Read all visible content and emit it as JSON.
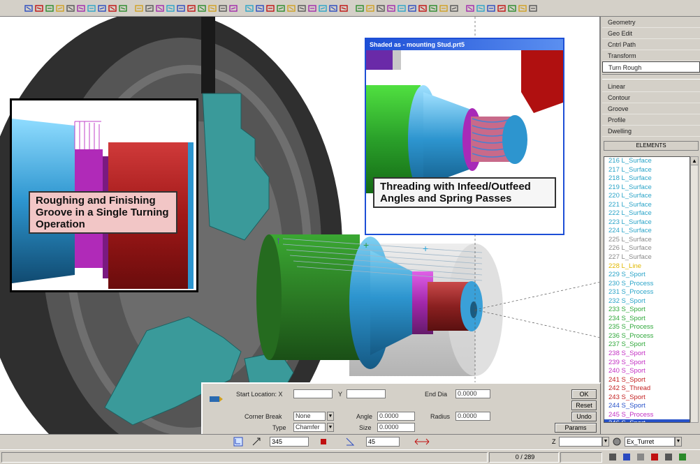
{
  "toolbar": {
    "icons": [
      "new-file-icon",
      "open-icon",
      "save-icon",
      "print-icon",
      "undo-icon",
      "redo-icon",
      "cut-icon",
      "copy-icon",
      "paste-icon",
      "select-icon",
      "mirror-icon",
      "wireframe-icon",
      "chart-icon",
      "tool-icon",
      "pen-icon",
      "curve-icon",
      "zoom-icon",
      "transform-icon",
      "dimension-icon",
      "grid-icon",
      "layer-icon",
      "view-icon",
      "rotate-icon",
      "move-icon",
      "scale-icon",
      "surface-icon",
      "solid-icon",
      "sketch-icon",
      "text-icon",
      "measure-icon",
      "render-icon",
      "shade-icon",
      "light-icon",
      "color-icon",
      "material-icon",
      "record-icon",
      "arrow-icon",
      "snap-icon",
      "ruler-icon",
      "chain-icon",
      "trim-icon",
      "settings-icon",
      "help-icon",
      "monitor-icon",
      "camera-icon",
      "wrench-icon",
      "filter-icon"
    ]
  },
  "insets": {
    "left_caption": "Roughing and Finishing Groove in a Single Turning Operation",
    "right_title": "Shaded as - mounting Stud.prt5",
    "right_caption": "Threading with Infeed/Outfeed Angles and Spring Passes"
  },
  "right_panel": {
    "top_buttons": [
      "Geometry",
      "Geo Edit",
      "Cntrl Path",
      "Transform",
      "Turn Rough"
    ],
    "active_top": "Turn Rough",
    "ops_buttons": [
      "Linear",
      "Contour",
      "Groove",
      "Profile",
      "Dwelling"
    ],
    "elements_title": "ELEMENTS",
    "elements": [
      {
        "text": "216 L_Surface",
        "color": "#2aa4c8"
      },
      {
        "text": "217 L_Surface",
        "color": "#2aa4c8"
      },
      {
        "text": "218 L_Surface",
        "color": "#2aa4c8"
      },
      {
        "text": "219 L_Surface",
        "color": "#2aa4c8"
      },
      {
        "text": "220 L_Surface",
        "color": "#2aa4c8"
      },
      {
        "text": "221 L_Surface",
        "color": "#2aa4c8"
      },
      {
        "text": "222 L_Surface",
        "color": "#2aa4c8"
      },
      {
        "text": "223 L_Surface",
        "color": "#2aa4c8"
      },
      {
        "text": "224 L_Surface",
        "color": "#2aa4c8"
      },
      {
        "text": "225 L_Surface",
        "color": "#8a8a8a"
      },
      {
        "text": "226 L_Surface",
        "color": "#8a8a8a"
      },
      {
        "text": "227 L_Surface",
        "color": "#8a8a8a"
      },
      {
        "text": "228 L_Line",
        "color": "#e0b800"
      },
      {
        "text": "229 S_Sport",
        "color": "#2aa4c8"
      },
      {
        "text": "230 S_Process",
        "color": "#2aa4c8"
      },
      {
        "text": "231 S_Process",
        "color": "#2aa4c8"
      },
      {
        "text": "232 S_Sport",
        "color": "#2aa4c8"
      },
      {
        "text": "233 S_Sport",
        "color": "#2fa83a"
      },
      {
        "text": "234 S_Sport",
        "color": "#2fa83a"
      },
      {
        "text": "235 S_Process",
        "color": "#2fa83a"
      },
      {
        "text": "236 S_Process",
        "color": "#2fa83a"
      },
      {
        "text": "237 S_Sport",
        "color": "#2fa83a"
      },
      {
        "text": "238 S_Sport",
        "color": "#c32fc3"
      },
      {
        "text": "239 S_Sport",
        "color": "#c32fc3"
      },
      {
        "text": "240 S_Sport",
        "color": "#c32fc3"
      },
      {
        "text": "241 S_Sport",
        "color": "#c42222"
      },
      {
        "text": "242 S_Thread",
        "color": "#c42222"
      },
      {
        "text": "243 S_Sport",
        "color": "#c42222"
      },
      {
        "text": "244 S_Sport",
        "color": "#2752c9"
      },
      {
        "text": "245 S_Process",
        "color": "#c32fc3"
      },
      {
        "text": "246 S_Sport",
        "color": "#ffffff"
      }
    ],
    "selected_index": 30
  },
  "dialog": {
    "start_location_label": "Start Location: X",
    "start_x": "",
    "y_label": "Y",
    "start_y": "",
    "end_dia_label": "End Dia",
    "end_dia": "0.0000",
    "corner_break_label": "Corner Break",
    "corner_break": "None",
    "type_label": "Type",
    "type": "Chamfer",
    "angle_label": "Angle",
    "angle": "0.0000",
    "size_label": "Size",
    "size": "0.0000",
    "radius_label": "Radius",
    "radius": "0.0000",
    "ok": "OK",
    "reset": "Reset",
    "undo": "Undo",
    "params": "Params"
  },
  "bottom_bar": {
    "field_a": "345",
    "field_b": "45",
    "coord_label": "Z",
    "combo": "Ex_Turret"
  },
  "status": {
    "count": "0 / 289"
  },
  "colors": {
    "chuck": "#5a5a5a",
    "jaw": "#3a9a9a",
    "green_stock": "#2f8a2a",
    "blue_part": "#2c8fc8",
    "groove": "#a22aa8",
    "thread": "#9a3030",
    "tool_red": "#b01010"
  }
}
